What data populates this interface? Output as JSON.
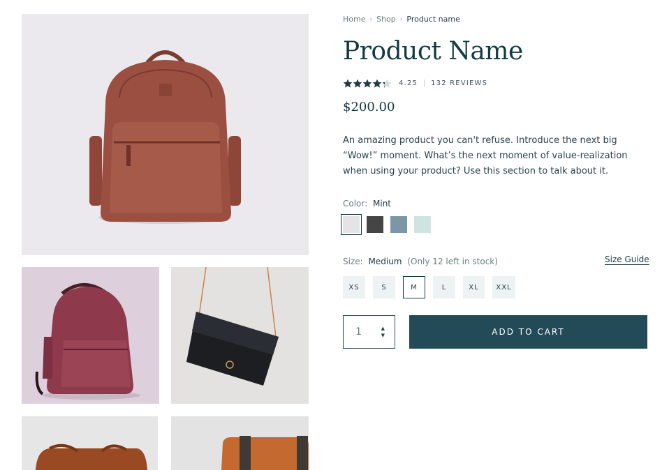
{
  "breadcrumb": {
    "items": [
      "Home",
      "Shop"
    ],
    "current": "Product name"
  },
  "product": {
    "name": "Product Name",
    "rating": "4.25",
    "rating_value": 4.25,
    "reviews": "132 REVIEWS",
    "price": "$200.00",
    "description": "An amazing product you can't refuse. Introduce the next big “Wow!” moment. What’s the next moment of value-realization when using your product? Use this section to talk about it."
  },
  "color": {
    "label": "Color:",
    "selected": "Mint",
    "swatches": [
      "#e3e4e3",
      "#454545",
      "#7b96a6",
      "#cfe4e1"
    ]
  },
  "size": {
    "label": "Size:",
    "selected": "Medium",
    "stock": "(Only 12 left in stock)",
    "guide": "Size Guide",
    "options": [
      "XS",
      "S",
      "M",
      "L",
      "XL",
      "XXL"
    ]
  },
  "quantity": {
    "value": "1"
  },
  "cart": {
    "button": "ADD TO CART"
  },
  "colors": {
    "accent": "#224a57",
    "title": "#123b45",
    "star": "#1e3a45"
  }
}
